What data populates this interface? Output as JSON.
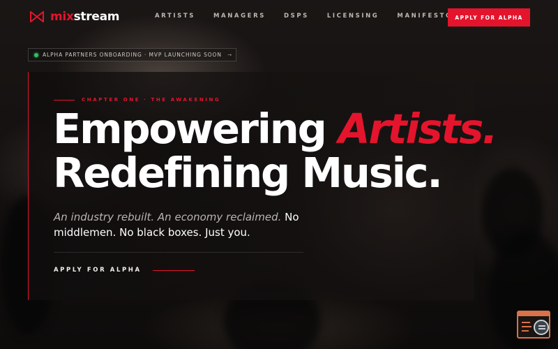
{
  "brand": {
    "name_part1": "mix",
    "name_part2": "stream",
    "logo_icon": "bowtie-logo-icon",
    "accent_color": "#e4142d"
  },
  "nav": {
    "items": [
      {
        "label": "ARTISTS"
      },
      {
        "label": "MANAGERS"
      },
      {
        "label": "DSPS"
      },
      {
        "label": "LICENSING"
      },
      {
        "label": "MANIFESTO"
      }
    ],
    "cta_label": "APPLY FOR ALPHA"
  },
  "announcement": {
    "text": "ALPHA PARTNERS ONBOARDING · MVP LAUNCHING SOON",
    "status_color": "#2fbf63",
    "arrow": "→"
  },
  "hero": {
    "chapter_label": "CHAPTER ONE · THE AWAKENING",
    "headline_line1_pre": "Empowering ",
    "headline_line1_accent": "Artists.",
    "headline_line2": "Redefining Music.",
    "sub_italic": "An industry rebuilt. An economy reclaimed.",
    "sub_strong": " No middlemen. No black boxes. Just you.",
    "cta_label": "APPLY FOR ALPHA"
  },
  "widget": {
    "icon": "page-search-icon"
  }
}
